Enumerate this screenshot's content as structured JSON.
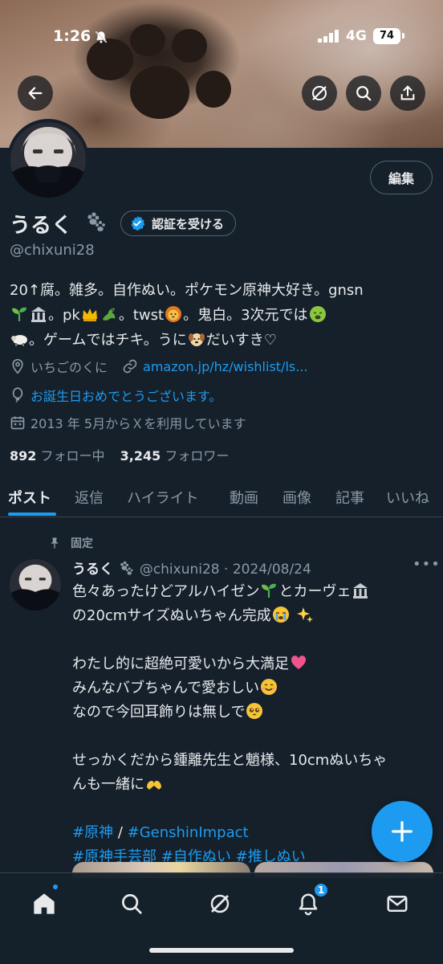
{
  "status": {
    "time": "1:26",
    "network": "4G",
    "battery": "74"
  },
  "profile": {
    "name": "うるく",
    "verify_label": "認証を受ける",
    "handle": "@chixuni28",
    "edit_label": "編集",
    "bio": {
      "line1": "20↑腐。雑多。自作ぬい。ポケモン原神大好き。gnsn",
      "line2a": "。pk",
      "line2b": "。twst",
      "line2c": "。鬼白。3次元では",
      "line3a": "。ゲームではチキ。うに",
      "line3b": "だいすき♡"
    },
    "location": "いちごのくに",
    "website": "amazon.jp/hz/wishlist/ls...",
    "birthday": "お誕生日おめでとうございます。",
    "joined": "2013 年 5月からＸを利用しています",
    "following_count": "892",
    "following_label": "フォロー中",
    "followers_count": "3,245",
    "followers_label": "フォロワー"
  },
  "tabs": [
    "ポスト",
    "返信",
    "ハイライト",
    "動画",
    "画像",
    "記事",
    "いいね"
  ],
  "post": {
    "pinned_label": "固定",
    "author": "うるく",
    "handle_date": "@chixuni28 · 2024/08/24",
    "line1a": "色々あったけどアルハイゼン",
    "line1b": "とカーヴェ",
    "line2a": "の20cmサイズぬいちゃん完成",
    "line3a": "わたし的に超絶可愛いから大満足",
    "line4a": "みんなバブちゃんで愛おしい",
    "line5a": "なので今回耳飾りは無しで",
    "line6": "せっかくだから鍾離先生と魈様、10cmぬいちゃ",
    "line7a": "んも一緒に",
    "tag1": "#原神",
    "tag_sep": " / ",
    "tag2": "#GenshinImpact",
    "tag3": "#原神手芸部",
    "tag4": "#自作ぬい",
    "tag5": "#推しぬい"
  },
  "nav": {
    "notification_count": "1"
  },
  "colors": {
    "background": "#15202b",
    "accent": "#1d9bf0",
    "muted": "#8b98a5",
    "text": "#e7e9ea",
    "border": "#38444d"
  }
}
